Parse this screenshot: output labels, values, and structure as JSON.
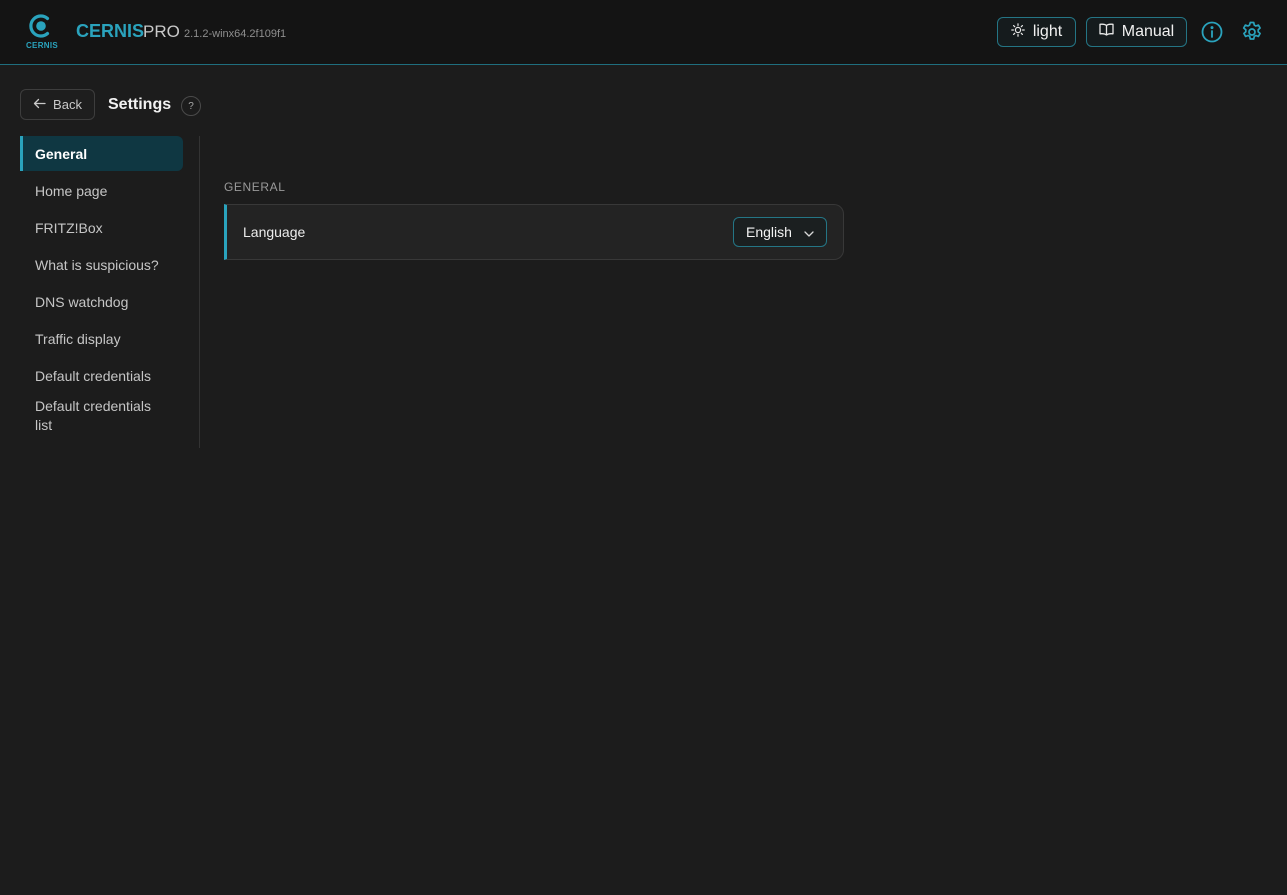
{
  "app": {
    "logo_text": "CERNIS",
    "name": "CERNIS",
    "edition": "PRO",
    "version": "2.1.2-winx64.2f109f1"
  },
  "header": {
    "theme_label": "light",
    "manual_label": "Manual",
    "icons": [
      "sun-icon",
      "book-icon",
      "info-icon",
      "gear-icon"
    ]
  },
  "page": {
    "back_label": "Back",
    "title": "Settings",
    "help_label": "?"
  },
  "sidebar": {
    "items": [
      {
        "label": "General",
        "active": true
      },
      {
        "label": "Home page"
      },
      {
        "label": "FRITZ!Box"
      },
      {
        "label": "What is suspicious?"
      },
      {
        "label": "DNS watchdog"
      },
      {
        "label": "Traffic display"
      },
      {
        "label": "Default credentials"
      },
      {
        "label": "Default credentials list"
      }
    ]
  },
  "content": {
    "section_title": "GENERAL",
    "language_label": "Language",
    "language_value": "English"
  },
  "colors": {
    "accent": "#2aa3bd",
    "background": "#1c1c1c",
    "topbar": "#141414",
    "active_nav": "#0f3742"
  }
}
